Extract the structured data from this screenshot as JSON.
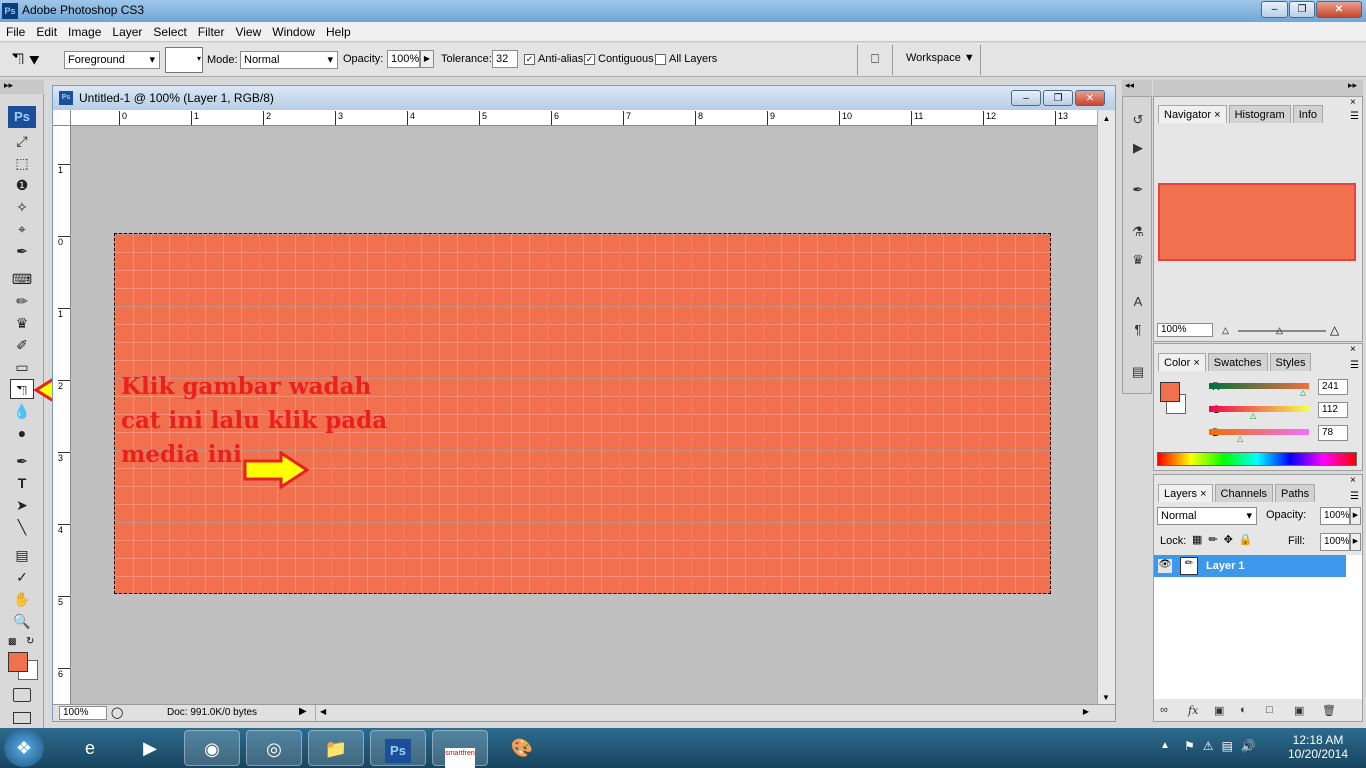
{
  "window": {
    "title": "Adobe Photoshop CS3",
    "icon": "Ps"
  },
  "menu": [
    "File",
    "Edit",
    "Image",
    "Layer",
    "Select",
    "Filter",
    "View",
    "Window",
    "Help"
  ],
  "options": {
    "fill_source": "Foreground",
    "mode_label": "Mode:",
    "mode_value": "Normal",
    "opacity_label": "Opacity:",
    "opacity_value": "100%",
    "tolerance_label": "Tolerance:",
    "tolerance_value": "32",
    "anti_alias": "Anti-alias",
    "contiguous": "Contiguous",
    "all_layers": "All Layers",
    "workspace": "Workspace"
  },
  "toolbox": {
    "logo": "Ps"
  },
  "document": {
    "title": "Untitled-1 @ 100% (Layer 1, RGB/8)",
    "ruler_top": [
      "0",
      "1",
      "2",
      "3",
      "4",
      "5",
      "6",
      "7",
      "8",
      "9",
      "10",
      "11",
      "12",
      "13"
    ],
    "ruler_left": [
      "1",
      "0",
      "1",
      "2",
      "3",
      "4",
      "5",
      "6"
    ],
    "zoom": "100%",
    "doc_info": "Doc: 991.0K/0 bytes",
    "fill_color": "#f1704e"
  },
  "annotation": {
    "line1": "Klik gambar wadah",
    "line2": "cat ini lalu klik pada",
    "line3": "media ini"
  },
  "navigator": {
    "tabs": [
      "Navigator",
      "Histogram",
      "Info"
    ],
    "zoom": "100%"
  },
  "color_panel": {
    "tabs": [
      "Color",
      "Swatches",
      "Styles"
    ],
    "r_label": "R",
    "r_value": "241",
    "g_label": "G",
    "g_value": "112",
    "b_label": "B",
    "b_value": "78",
    "foreground": "#f1704e"
  },
  "layers_panel": {
    "tabs": [
      "Layers",
      "Channels",
      "Paths"
    ],
    "blend_mode": "Normal",
    "opacity_label": "Opacity:",
    "opacity_value": "100%",
    "lock_label": "Lock:",
    "fill_label": "Fill:",
    "fill_value": "100%",
    "layer_name": "Layer 1"
  },
  "taskbar": {
    "time": "12:18 AM",
    "date": "10/20/2014",
    "photoshop_label": "Ps",
    "smartfren_label": "smartfren"
  }
}
